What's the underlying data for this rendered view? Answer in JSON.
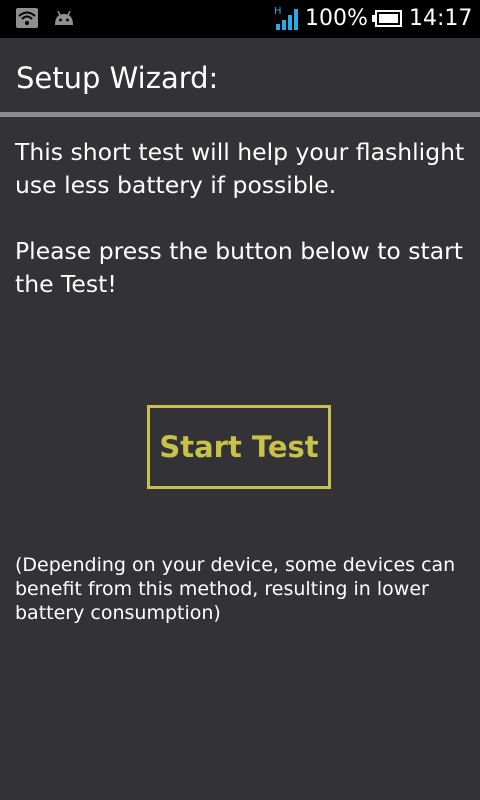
{
  "status_bar": {
    "network_type": "H",
    "battery_percent": "100%",
    "time": "14:17",
    "icons": [
      "wifi-icon",
      "android-icon",
      "signal-icon",
      "battery-icon"
    ]
  },
  "title": "Setup Wizard:",
  "intro": {
    "line1": "This short test will help your flashlight use less battery if possible.",
    "line2": "Please press the button below to start the Test!"
  },
  "start_button_label": "Start Test",
  "note": "(Depending on your device, some devices can benefit from this method, resulting in lower battery consumption)",
  "colors": {
    "background": "#333236",
    "accent": "#c8c248",
    "divider": "#8c8c8c",
    "network_type": "#29a9e6"
  }
}
